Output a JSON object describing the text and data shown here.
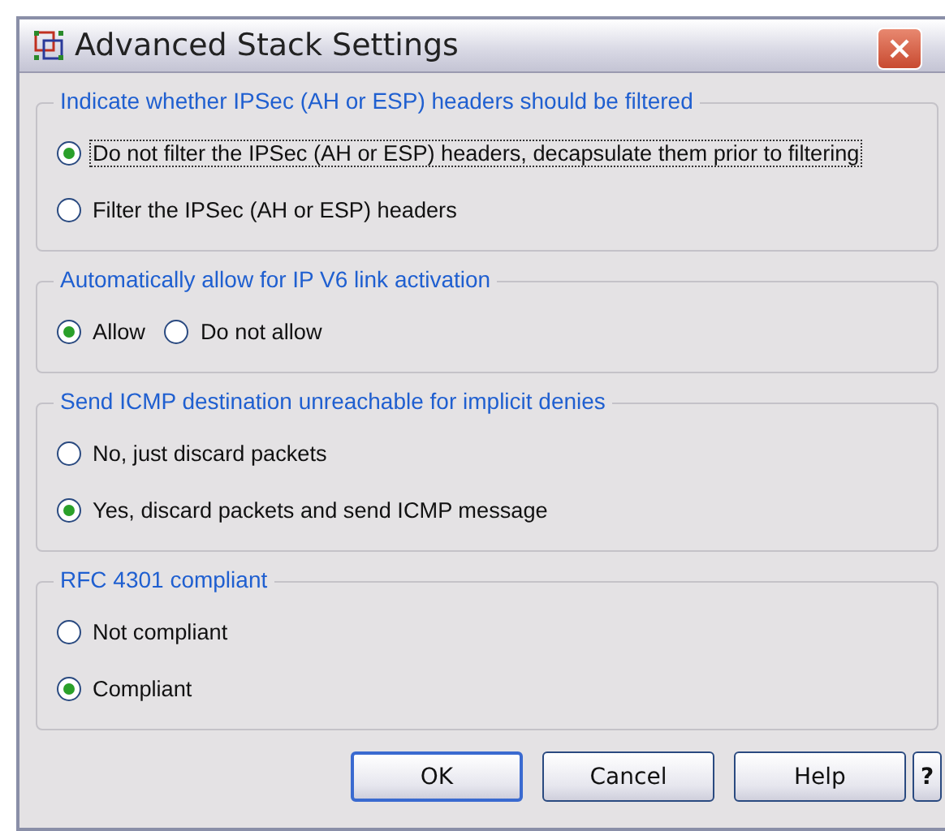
{
  "window": {
    "title": "Advanced Stack Settings"
  },
  "groups": [
    {
      "title": "Indicate whether IPSec (AH or ESP) headers should be filtered",
      "kind": "stacked",
      "options": [
        {
          "label": "Do not filter the IPSec (AH or ESP) headers, decapsulate them prior to filtering",
          "selected": true,
          "focused": true
        },
        {
          "label": "Filter the IPSec (AH or ESP) headers",
          "selected": false,
          "focused": false
        }
      ]
    },
    {
      "title": "Automatically allow for IP V6 link activation",
      "kind": "inline",
      "options": [
        {
          "label": "Allow",
          "selected": true,
          "focused": false
        },
        {
          "label": "Do not allow",
          "selected": false,
          "focused": false
        }
      ]
    },
    {
      "title": "Send ICMP destination unreachable for implicit denies",
      "kind": "stacked",
      "options": [
        {
          "label": "No, just discard packets",
          "selected": false,
          "focused": false
        },
        {
          "label": "Yes, discard packets and send ICMP message",
          "selected": true,
          "focused": false
        }
      ]
    },
    {
      "title": "RFC 4301 compliant",
      "kind": "stacked",
      "options": [
        {
          "label": "Not compliant",
          "selected": false,
          "focused": false
        },
        {
          "label": "Compliant",
          "selected": true,
          "focused": false
        }
      ]
    }
  ],
  "buttons": [
    {
      "label": "OK",
      "default": true
    },
    {
      "label": "Cancel",
      "default": false
    },
    {
      "label": "Help",
      "default": false
    },
    {
      "label": "?",
      "default": false
    }
  ]
}
